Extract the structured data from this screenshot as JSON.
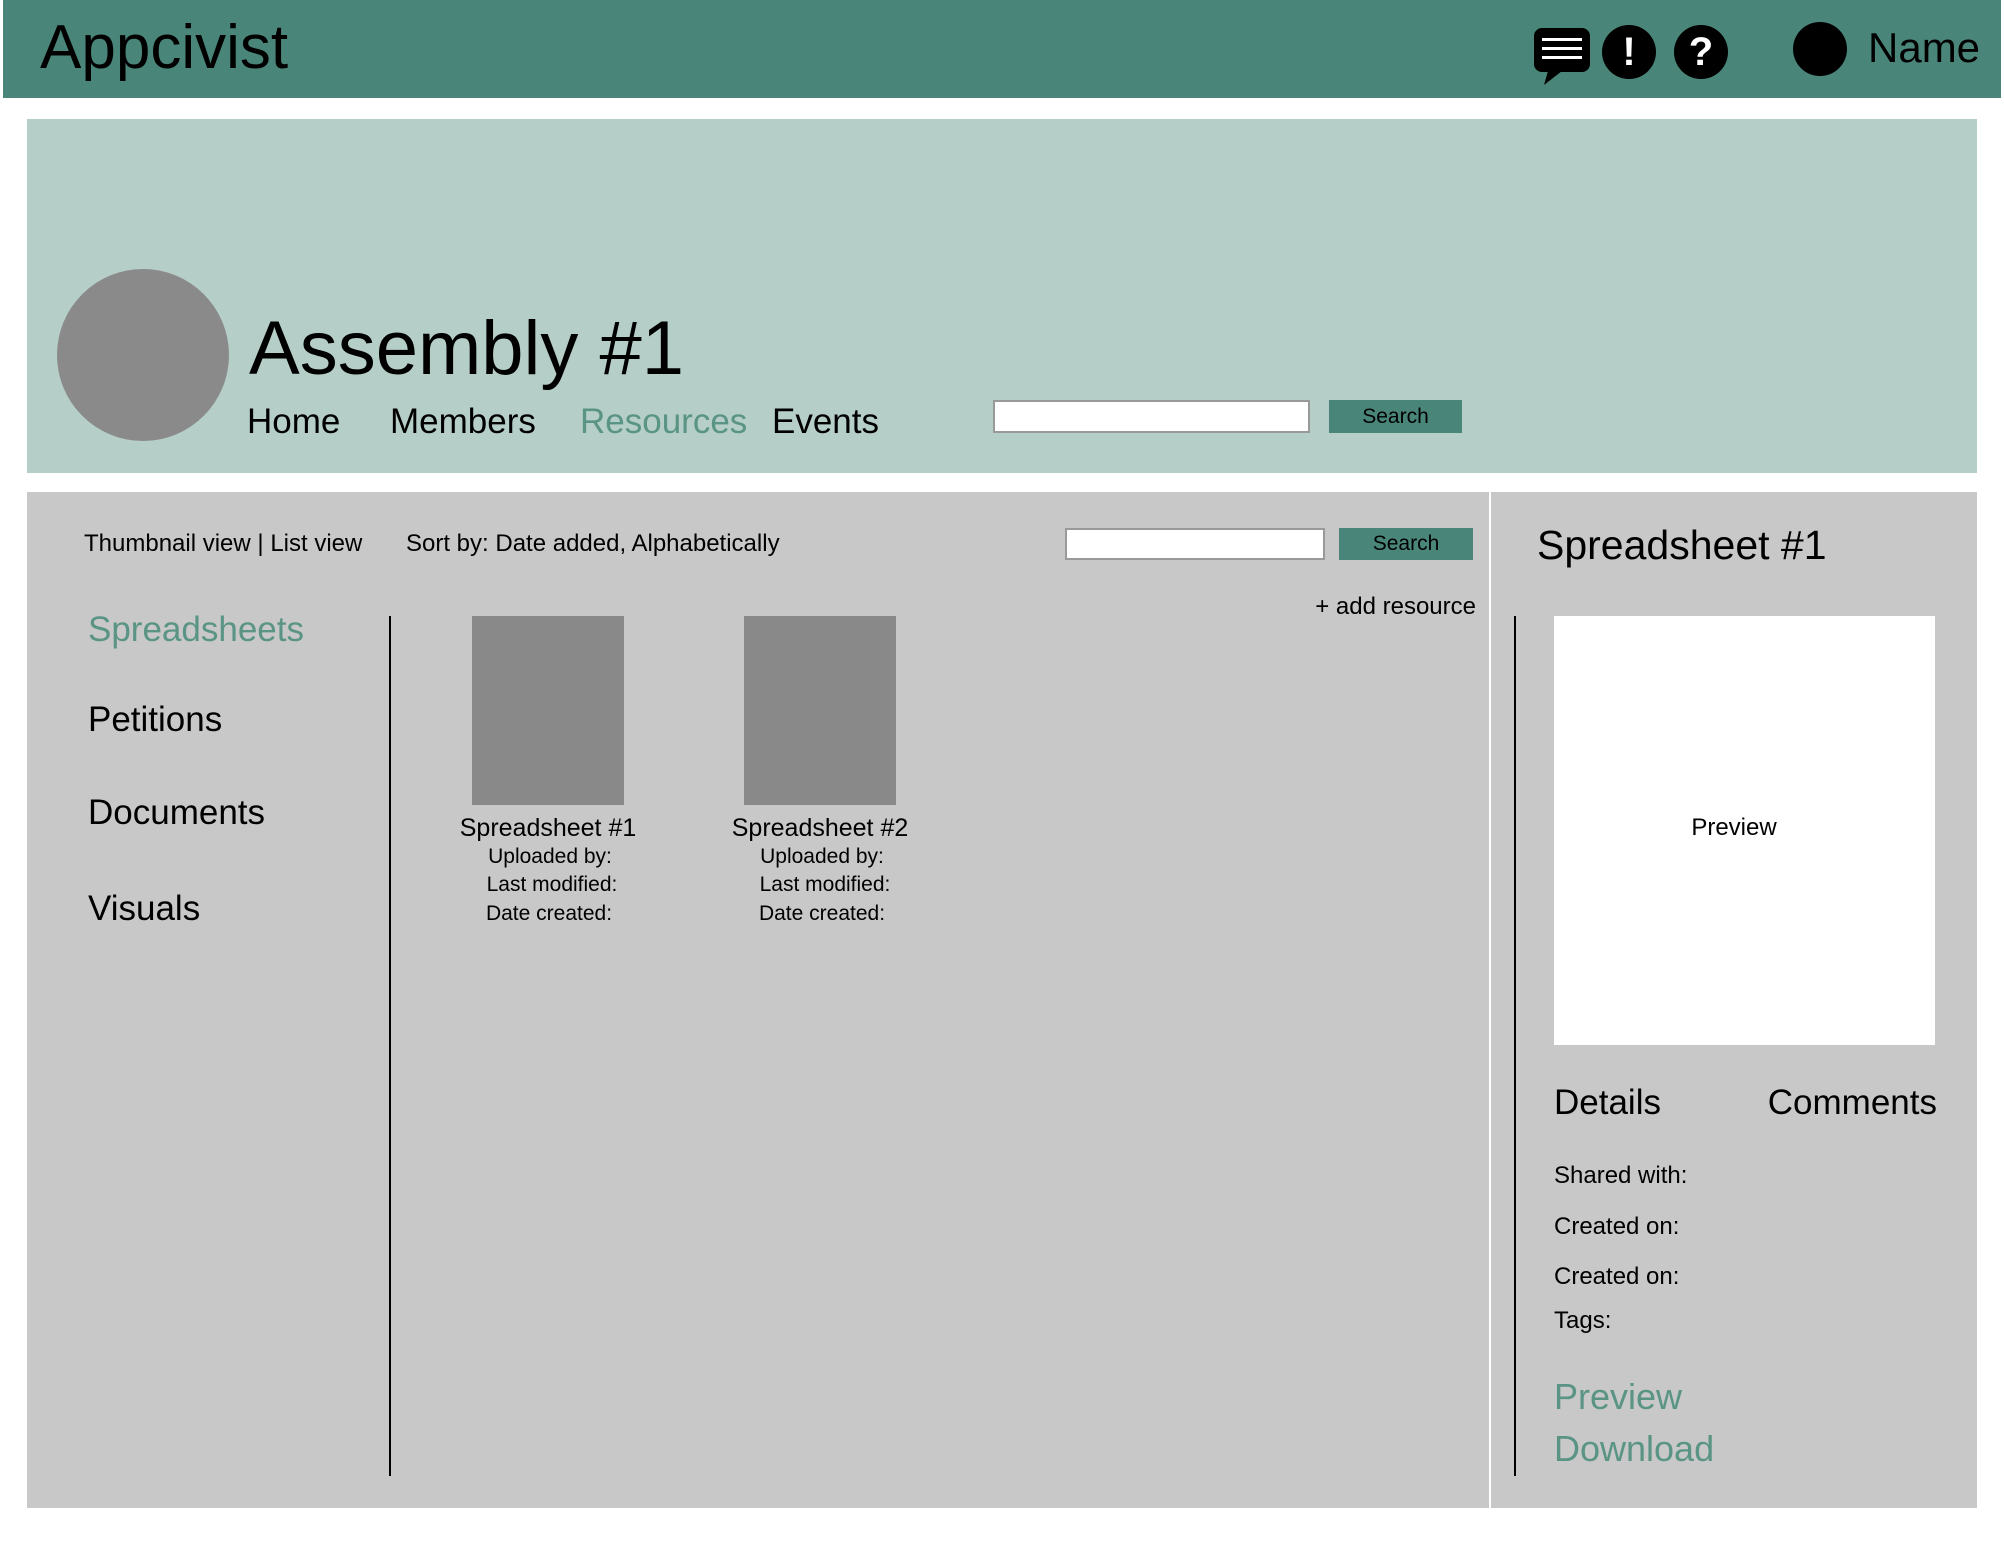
{
  "app": {
    "title": "Appcivist",
    "user_name": "Name",
    "icons": [
      "chat-icon",
      "alert-icon",
      "help-icon",
      "avatar"
    ],
    "accent": "#4a857a",
    "link_color": "#5a9484"
  },
  "assembly": {
    "title": "Assembly #1",
    "nav": [
      {
        "label": "Home"
      },
      {
        "label": "Members"
      },
      {
        "label": "Resources",
        "active": true
      },
      {
        "label": "Events"
      }
    ],
    "search_placeholder": "",
    "search_label": "Search"
  },
  "toolbar": {
    "thumbnail_view": "Thumbnail view",
    "separator": "|",
    "list_view": "List view",
    "sort_by": "Sort by: Date added, Alphabetically",
    "search_label": "Search",
    "add_resource": "+ add resource"
  },
  "categories": [
    {
      "label": "Spreadsheets",
      "active": true
    },
    {
      "label": "Petitions"
    },
    {
      "label": "Documents"
    },
    {
      "label": "Visuals"
    }
  ],
  "resources": [
    {
      "title": "Spreadsheet #1",
      "uploaded": "Uploaded by:",
      "modified": "Last modified:",
      "created": "Date created:"
    },
    {
      "title": "Spreadsheet #2",
      "uploaded": "Uploaded by:",
      "modified": "Last modified:",
      "created": "Date created:"
    }
  ],
  "detail": {
    "title": "Spreadsheet #1",
    "preview_text": "Preview",
    "tabs": [
      "Details",
      "Comments"
    ],
    "fields": [
      "Shared with:",
      "Created on:",
      "Created on:",
      "Tags:"
    ],
    "links": [
      "Preview",
      "Download"
    ]
  }
}
